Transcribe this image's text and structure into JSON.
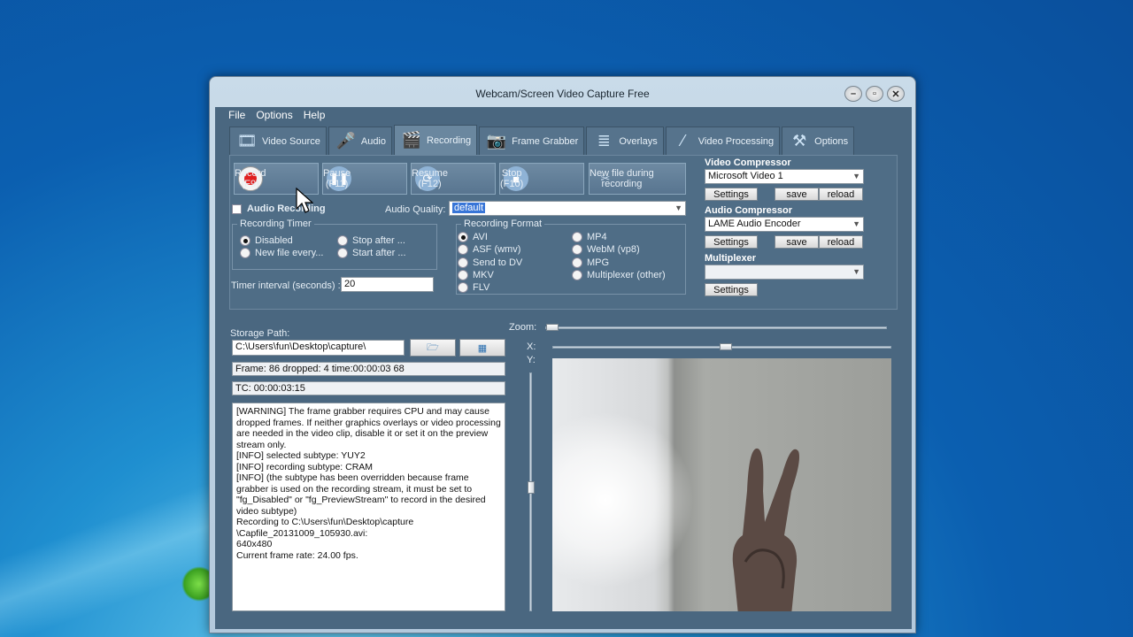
{
  "window": {
    "title": "Webcam/Screen Video Capture Free"
  },
  "menu": [
    "File",
    "Options",
    "Help"
  ],
  "tabs": [
    {
      "label": "Video Source",
      "icon": "film-icon"
    },
    {
      "label": "Audio",
      "icon": "microphone-icon"
    },
    {
      "label": "Recording",
      "icon": "film-record-icon"
    },
    {
      "label": "Frame Grabber",
      "icon": "camera-icon"
    },
    {
      "label": "Overlays",
      "icon": "layers-icon"
    },
    {
      "label": "Video Processing",
      "icon": "wand-icon"
    },
    {
      "label": "Options",
      "icon": "tools-icon"
    }
  ],
  "buttons": {
    "record": {
      "label": "Record",
      "key": "(F9)"
    },
    "pause": {
      "label": "Pause",
      "key": "(F11)"
    },
    "resume": {
      "label": "Resume",
      "key": "(F12)"
    },
    "stop": {
      "label": "Stop",
      "key": "(F10)"
    },
    "newfile": {
      "label": "New file during",
      "label2": "recording"
    }
  },
  "audio": {
    "recording_label": "Audio Recording",
    "recording_checked": false,
    "quality_label": "Audio Quality:",
    "quality_value": "default"
  },
  "timer": {
    "group_title": "Recording Timer",
    "options": [
      "Disabled",
      "New file every...",
      "Stop after ...",
      "Start after ..."
    ],
    "selected": "Disabled",
    "interval_label": "Timer interval (seconds) :",
    "interval_value": "20"
  },
  "format": {
    "group_title": "Recording Format",
    "options_left": [
      "AVI",
      "ASF (wmv)",
      "Send to DV",
      "MKV",
      "FLV"
    ],
    "options_right": [
      "MP4",
      "WebM (vp8)",
      "MPG",
      "Multiplexer (other)"
    ],
    "selected": "AVI"
  },
  "compressor": {
    "video_title": "Video Compressor",
    "video_value": "Microsoft Video 1",
    "audio_title": "Audio Compressor",
    "audio_value": "LAME Audio Encoder",
    "mux_title": "Multiplexer",
    "mux_value": "",
    "settings": "Settings",
    "save": "save",
    "reload": "reload"
  },
  "storage": {
    "label": "Storage Path:",
    "path": "C:\\Users\\fun\\Desktop\\capture\\",
    "frame_info": "Frame: 86 dropped: 4 time:00:00:03 68",
    "tc_info": "TC: 00:00:03:15"
  },
  "log": [
    "[WARNING] The frame grabber requires CPU and may cause dropped frames. If neither graphics overlays or video processing are needed in the video clip, disable it or set it on the preview stream only.",
    "[INFO] selected subtype: YUY2",
    "[INFO] recording subtype: CRAM",
    "[INFO] (the subtype has been overridden because frame grabber is used on the recording stream, it must be set to \"fg_Disabled\" or \"fg_PreviewStream\" to record in the desired video subtype)",
    "Recording to C:\\Users\\fun\\Desktop\\capture \\Capfile_20131009_105930.avi:",
    "640x480",
    "Current frame rate: 24.00 fps."
  ],
  "preview": {
    "zoom_label": "Zoom:",
    "x_label": "X:",
    "y_label": "Y:"
  },
  "colors": {
    "panel": "#4f6d86",
    "client": "#4a6780",
    "record_red": "#e02020"
  }
}
